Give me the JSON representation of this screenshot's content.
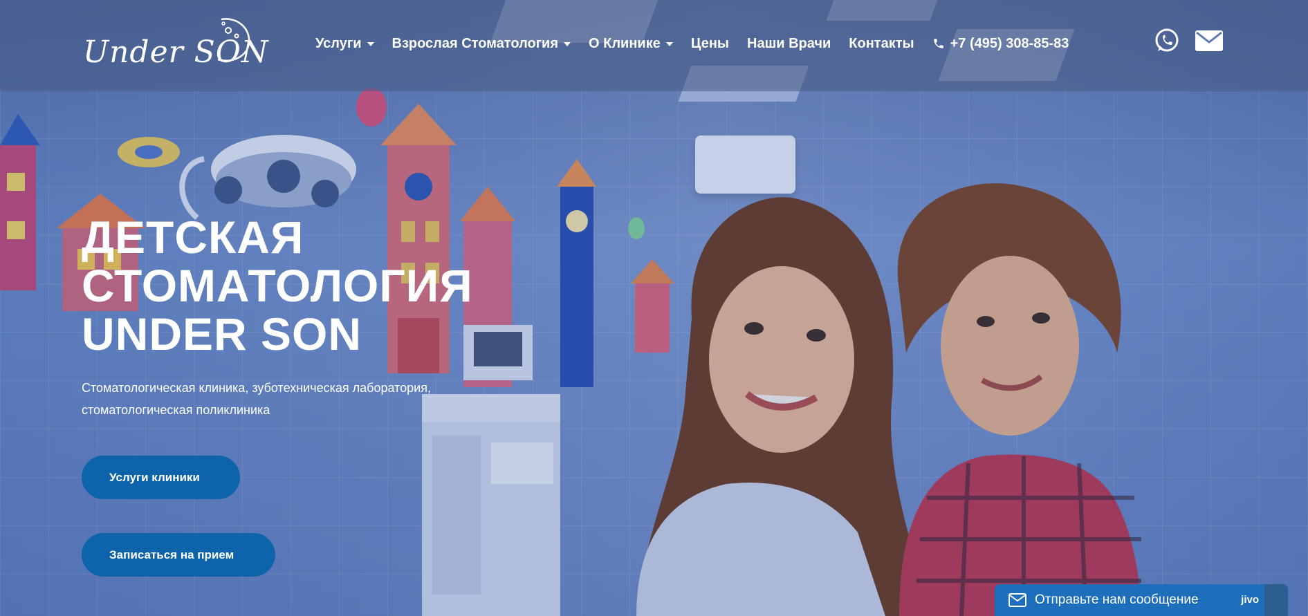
{
  "colors": {
    "accent": "#0d64aa",
    "header_bg": "#4f6a9a",
    "chat_bg": "#1e6fbb"
  },
  "logo": {
    "text": "Under SON",
    "icon": "moon-logo-icon"
  },
  "nav": {
    "items": [
      {
        "label": "Услуги",
        "has_dropdown": true
      },
      {
        "label": "Взрослая Стоматология",
        "has_dropdown": true
      },
      {
        "label": "О Клинике",
        "has_dropdown": true
      },
      {
        "label": "Цены",
        "has_dropdown": false
      },
      {
        "label": "Наши Врачи",
        "has_dropdown": false
      },
      {
        "label": "Контакты",
        "has_dropdown": false
      }
    ],
    "phone": "+7 (495) 308-85-83",
    "phone_icon": "phone-icon",
    "whatsapp_icon": "whatsapp-icon",
    "email_icon": "envelope-icon"
  },
  "hero": {
    "title_lines": [
      "ДЕТСКАЯ",
      "СТОМАТОЛОГИЯ",
      "UNDER SON"
    ],
    "subtitle_lines": [
      "Стоматологическая клиника, зуботехническая лаборатория,",
      "стоматологическая поликлиника"
    ],
    "buttons": [
      {
        "label": "Услуги клиники"
      },
      {
        "label": "Записаться на прием"
      }
    ]
  },
  "chat": {
    "label": "Отправьте нам сообщение",
    "brand": "jivo",
    "icon": "mail-icon"
  }
}
